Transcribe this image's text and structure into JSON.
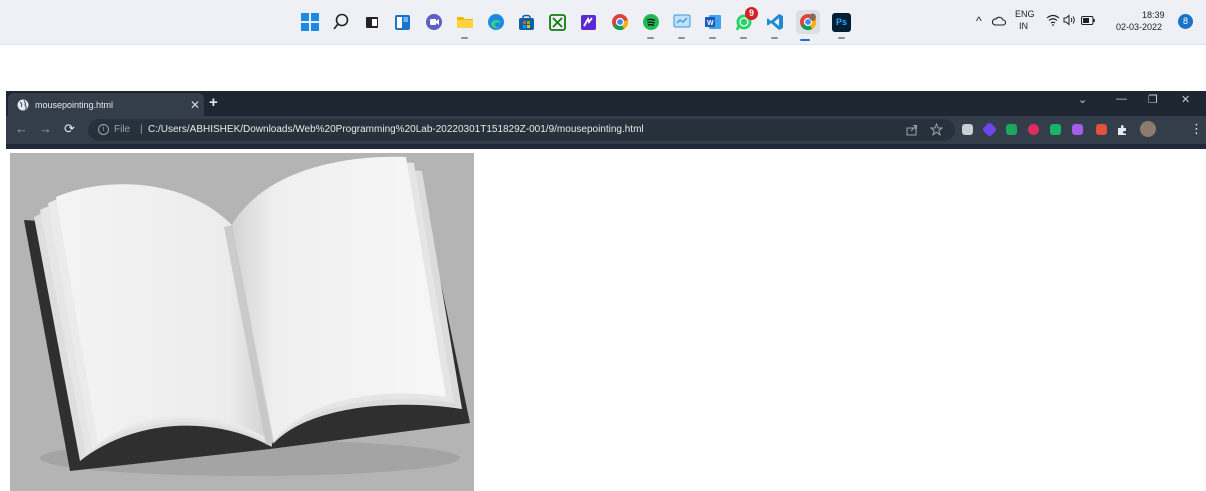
{
  "taskbar": {
    "pinned_apps": [
      {
        "name": "start"
      },
      {
        "name": "search"
      },
      {
        "name": "task-view"
      },
      {
        "name": "widgets"
      },
      {
        "name": "teams-chat"
      },
      {
        "name": "file-explorer"
      },
      {
        "name": "edge"
      },
      {
        "name": "microsoft-store"
      },
      {
        "name": "xbox"
      },
      {
        "name": "app-purple"
      },
      {
        "name": "chrome"
      },
      {
        "name": "spotify"
      },
      {
        "name": "app-blue"
      },
      {
        "name": "word"
      },
      {
        "name": "whatsapp",
        "badge": "9"
      },
      {
        "name": "vscode"
      },
      {
        "name": "chrome-profile"
      },
      {
        "name": "photoshop",
        "label": "Ps"
      }
    ],
    "tray": {
      "chevron": "^",
      "lang_top": "ENG",
      "lang_bottom": "IN",
      "time": "18:39",
      "date": "02-03-2022",
      "notification_count": "8"
    }
  },
  "browser": {
    "tab_title": "mousepointing.html",
    "address_prefix": "File",
    "address_separator": "|",
    "url": "C:/Users/ABHISHEK/Downloads/Web%20Programming%20Lab-20220301T151829Z-001/9/mousepointing.html"
  },
  "colors": {
    "taskbar_bg": "#eef0f6",
    "browser_frame": "#1e2731",
    "browser_toolbar": "#333e4a",
    "accent_blue": "#1a8ae6"
  }
}
